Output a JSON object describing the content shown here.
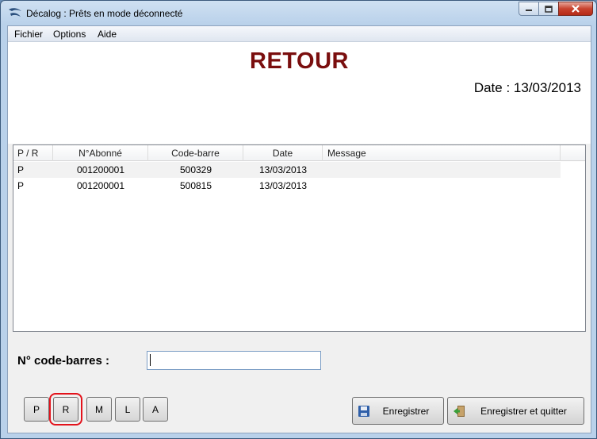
{
  "window": {
    "title": "Décalog : Prêts en mode déconnecté"
  },
  "menu": {
    "items": [
      "Fichier",
      "Options",
      "Aide"
    ]
  },
  "header": {
    "title": "RETOUR",
    "date_text": "Date : 13/03/2013"
  },
  "table": {
    "columns": [
      "P / R",
      "N°Abonné",
      "Code-barre",
      "Date",
      "Message"
    ],
    "rows": [
      {
        "pr": "P",
        "abonne": "001200001",
        "code": "500329",
        "date": "13/03/2013",
        "message": ""
      },
      {
        "pr": "P",
        "abonne": "001200001",
        "code": "500815",
        "date": "13/03/2013",
        "message": ""
      }
    ]
  },
  "scanner": {
    "label": "N° code-barres :",
    "value": ""
  },
  "mode_buttons": [
    "P",
    "R",
    "M",
    "L",
    "A"
  ],
  "selected_mode": "R",
  "actions": {
    "save_label": "Enregistrer",
    "save_quit_label": "Enregistrer et quitter"
  },
  "icons": {
    "app": "decalog-logo-icon",
    "save": "floppy-disk-icon",
    "save_quit": "exit-door-icon"
  },
  "colors": {
    "title_color": "#7a0e0e",
    "selection_frame": "#e3121b"
  }
}
